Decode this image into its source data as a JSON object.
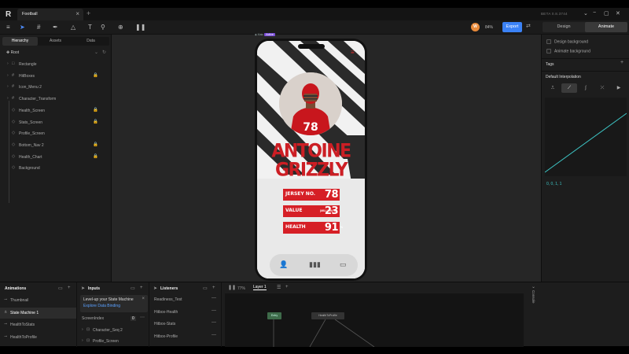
{
  "app": {
    "title": "Football",
    "version": "BETA 0.8.3744"
  },
  "toolbar": {
    "zoom": "84%",
    "export_label": "Export",
    "avatar_initial": "W",
    "mode_tabs": [
      "Design",
      "Animate"
    ],
    "active_mode": "Animate"
  },
  "left_panel": {
    "tabs": [
      "Hierarchy",
      "Assets",
      "Data"
    ],
    "active_tab": "Hierarchy",
    "root_label": "Root",
    "layers": [
      {
        "label": "Rectangle",
        "icon": "rect-icon",
        "locked": false
      },
      {
        "label": "HitBoxes",
        "icon": "hash-icon",
        "locked": true
      },
      {
        "label": "Icon_Menu 2",
        "icon": "hash-icon",
        "locked": false
      },
      {
        "label": "Character_Transform",
        "icon": "hash-icon",
        "locked": false
      },
      {
        "label": "Health_Screen",
        "icon": "diamond-icon",
        "locked": true
      },
      {
        "label": "Stats_Screen",
        "icon": "diamond-icon",
        "locked": true
      },
      {
        "label": "Profile_Screen",
        "icon": "diamond-icon",
        "locked": false
      },
      {
        "label": "Bottom_Nav 2",
        "icon": "diamond-icon",
        "locked": true
      },
      {
        "label": "Health_Chart",
        "icon": "diamond-icon",
        "locked": true
      },
      {
        "label": "Background",
        "icon": "diamond-icon",
        "locked": false
      }
    ]
  },
  "artboard": {
    "label": "Main",
    "badge": "Active",
    "player_first": "ANTOINE",
    "player_last": "GRIZZLY",
    "jersey_number": "78",
    "stats": [
      {
        "key": "JERSEY NO.",
        "unit": "",
        "value": "78"
      },
      {
        "key": "VALUE",
        "unit": "(MILLION) $",
        "value": "23"
      },
      {
        "key": "HEALTH",
        "unit": "%",
        "value": "91"
      }
    ]
  },
  "right_panel": {
    "design_bg_label": "Design background",
    "animate_bg_label": "Animate background",
    "tags_label": "Tags",
    "interp_label": "Default Interpolation",
    "curve_value": "0, 0, 1, 1"
  },
  "animations": {
    "title": "Animations",
    "items": [
      "Thumbnail",
      "State Machine 1",
      "HealthToStats",
      "HealthToProfile"
    ],
    "active": "State Machine 1"
  },
  "inputs": {
    "title": "Inputs",
    "tip_title": "Level-up your State Machine",
    "tip_link": "Explore Data Binding",
    "items": [
      {
        "label": "ScreenIndex",
        "value": "0"
      },
      {
        "label": "Character_Seq 2",
        "value": ""
      },
      {
        "label": "Profile_Screen",
        "value": ""
      }
    ]
  },
  "listeners": {
    "title": "Listeners",
    "items": [
      "Readiness_Test",
      "Hitbox-Health",
      "Hitbox-Stats",
      "Hitbox-Profile"
    ]
  },
  "graph": {
    "zoom": "77%",
    "layer_tab": "Layer 1",
    "nodes": [
      "Entry",
      "HealthToProfile"
    ]
  },
  "console_label": "Console",
  "colors": {
    "accent": "#3b82f6",
    "brand_red": "#d61f26",
    "curve": "#3dc4c4"
  }
}
